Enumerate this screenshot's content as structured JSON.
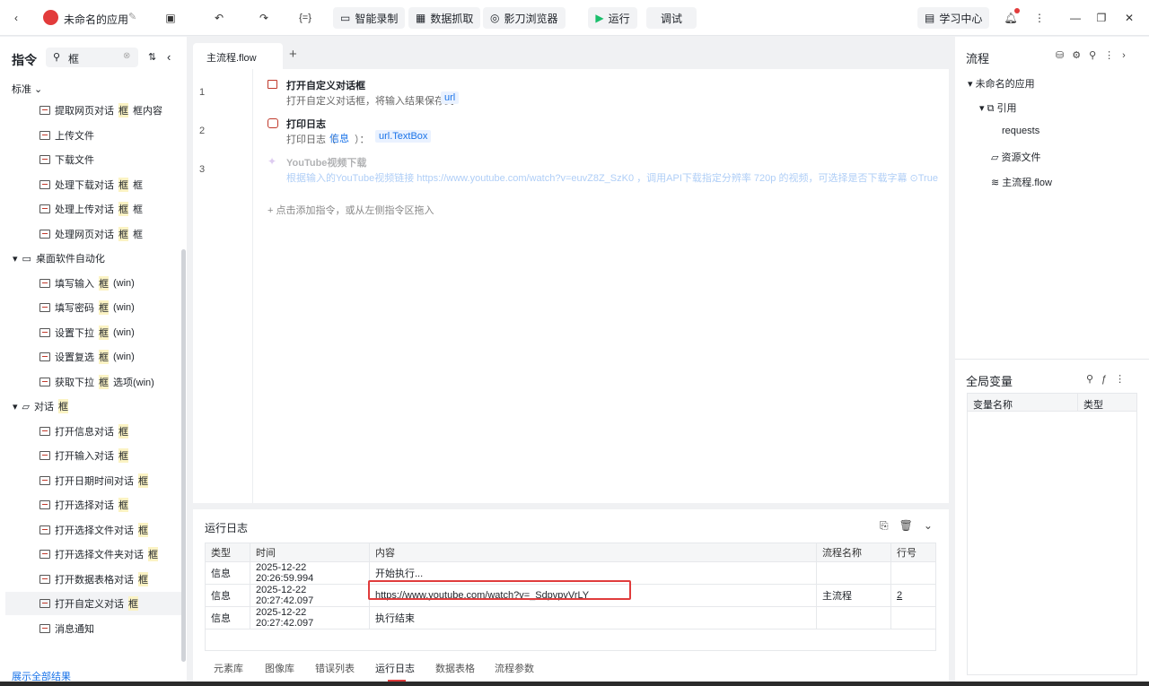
{
  "app": {
    "title": "未命名的应用"
  },
  "toolbar": {
    "smart_record": "智能录制",
    "data_grab": "数据抓取",
    "browser": "影刀浏览器",
    "run": "运行",
    "debug": "调试",
    "learn": "学习中心"
  },
  "left": {
    "title": "指令",
    "search_value": "框",
    "category": "标准",
    "show_all": "展示全部结果",
    "items_a": [
      "提取网页对话",
      "上传文件",
      "下载文件",
      "处理下载对话",
      "处理上传对话",
      "处理网页对话"
    ],
    "items_a_suffix": [
      "框内容",
      "",
      "",
      "框",
      "框",
      "框"
    ],
    "group1": "桌面软件自动化",
    "items_b": [
      "填写输入",
      "填写密码",
      "设置下拉",
      "设置复选",
      "获取下拉"
    ],
    "items_b_suffix": [
      "(win)",
      "(win)",
      "(win)",
      "(win)",
      "选项(win)"
    ],
    "group2": "对话",
    "items_c": [
      "打开信息对话",
      "打开输入对话",
      "打开日期时间对话",
      "打开选择对话",
      "打开选择文件对话",
      "打开选择文件夹对话",
      "打开数据表格对话",
      "打开自定义对话"
    ],
    "item_last": "消息通知",
    "hl": "框"
  },
  "editor": {
    "tab": "主流程.flow",
    "lines": [
      "1",
      "2",
      "3"
    ],
    "cmd1_title": "打开自定义对话框",
    "cmd1_desc": "打开自定义对话框，将输入结果保存到",
    "cmd1_var": "url",
    "cmd2_title": "打印日志",
    "cmd2_desc": "打印日志（",
    "cmd2_tag": "信息",
    "cmd2_mid": "）：",
    "cmd2_var": "url.TextBox",
    "cmd3_title": "YouTube视频下载",
    "cmd3_desc": "根据输入的YouTube视频链接 https://www.youtube.com/watch?v=euvZ8Z_SzK0 ，调用API下载指定分辨率 720p 的视频，可选择是否下载字幕 ⊙True",
    "add_hint": "点击添加指令，或从左侧指令区拖入"
  },
  "right": {
    "title": "流程",
    "tree": [
      "未命名的应用",
      "引用",
      "requests",
      "资源文件",
      "主流程.flow"
    ],
    "vars_title": "全局变量",
    "var_cols": [
      "变量名称",
      "类型"
    ]
  },
  "log": {
    "title": "运行日志",
    "cols": [
      "类型",
      "时间",
      "内容",
      "流程名称",
      "行号"
    ],
    "rows": [
      [
        "信息",
        "2025-12-22 20:26:59.994",
        "开始执行...",
        "",
        ""
      ],
      [
        "信息",
        "2025-12-22 20:27:42.097",
        "https://www.youtube.com/watch?v=_SdpvpvVrLY",
        "主流程",
        "2"
      ],
      [
        "信息",
        "2025-12-22 20:27:42.097",
        "执行结束",
        "",
        ""
      ]
    ],
    "tabs": [
      "元素库",
      "图像库",
      "错误列表",
      "运行日志",
      "数据表格",
      "流程参数"
    ]
  }
}
